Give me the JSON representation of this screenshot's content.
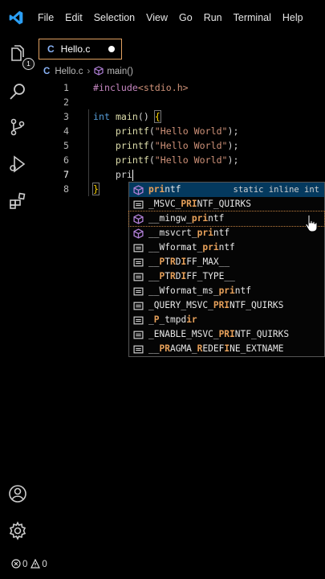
{
  "colors": {
    "accent": "#007acc",
    "match": "#e8a15a",
    "tab_border": "#e0a060"
  },
  "menubar": {
    "logo_icon": "vscode-logo",
    "items": [
      "File",
      "Edit",
      "Selection",
      "View",
      "Go",
      "Run",
      "Terminal",
      "Help"
    ]
  },
  "activity_bar": {
    "top_icons": [
      "explorer-icon",
      "search-icon",
      "source-control-icon",
      "run-debug-icon",
      "extensions-icon"
    ],
    "explorer_badge": "1",
    "bottom_icons": [
      "account-icon",
      "settings-gear-icon"
    ]
  },
  "tab": {
    "icon_label": "C",
    "label": "Hello.c",
    "modified": true
  },
  "breadcrumb": {
    "file_icon_label": "C",
    "file": "Hello.c",
    "symbol": "main()"
  },
  "editor": {
    "lines": [
      {
        "num": "1",
        "text": "#include<stdio.h>"
      },
      {
        "num": "2",
        "text": ""
      },
      {
        "num": "3",
        "text": "int main() {"
      },
      {
        "num": "4",
        "text": "    printf(\"Hello World\");"
      },
      {
        "num": "5",
        "text": "    printf(\"Hello World\");"
      },
      {
        "num": "6",
        "text": "    printf(\"Hello World\");"
      },
      {
        "num": "7",
        "text": "    pri"
      },
      {
        "num": "8",
        "text": "}"
      }
    ],
    "active_line": "7"
  },
  "suggestions": {
    "items": [
      {
        "prefix": "",
        "match": "pri",
        "rest": "ntf",
        "icon": "method-icon",
        "detail": "static inline int",
        "selected": true
      },
      {
        "prefix": "_MSVC_",
        "match": "PRI",
        "rest": "NTF_QUIRKS",
        "icon": "constant-icon"
      },
      {
        "prefix": "__mingw_",
        "match": "pri",
        "rest": "ntf",
        "icon": "method-icon",
        "hover": true
      },
      {
        "prefix": "__msvcrt_",
        "match": "pri",
        "rest": "ntf",
        "icon": "method-icon"
      },
      {
        "prefix": "__Wformat_",
        "match": "pri",
        "rest": "ntf",
        "icon": "constant-icon"
      },
      {
        "prefix": "__",
        "match": "P",
        "pre2": "T",
        "match2": "R",
        "mid": "D",
        "match3": "I",
        "rest": "FF_MAX__",
        "icon": "constant-icon"
      },
      {
        "prefix": "__",
        "match": "P",
        "pre2": "T",
        "match2": "R",
        "mid": "D",
        "match3": "I",
        "rest": "FF_TYPE__",
        "icon": "constant-icon"
      },
      {
        "prefix": "__Wformat_ms_",
        "match": "pri",
        "rest": "ntf",
        "icon": "constant-icon"
      },
      {
        "prefix": "_QUERY_MSVC_",
        "match": "PRI",
        "rest": "NTF_QUIRKS",
        "icon": "constant-icon"
      },
      {
        "prefix": "_",
        "match": "P",
        "pre2": "_tmpd",
        "match2": "ir",
        "rest": "",
        "icon": "constant-icon"
      },
      {
        "prefix": "_ENABLE_MSVC_",
        "match": "PRI",
        "rest": "NTF_QUIRKS",
        "icon": "constant-icon"
      },
      {
        "prefix": "__",
        "match": "PR",
        "pre2": "AGMA_",
        "match2": "R",
        "mid": "EDEF",
        "match3": "I",
        "rest": "NE_EXTNAME",
        "icon": "constant-icon"
      }
    ]
  },
  "statusbar": {
    "errors": "0",
    "warnings": "0"
  }
}
